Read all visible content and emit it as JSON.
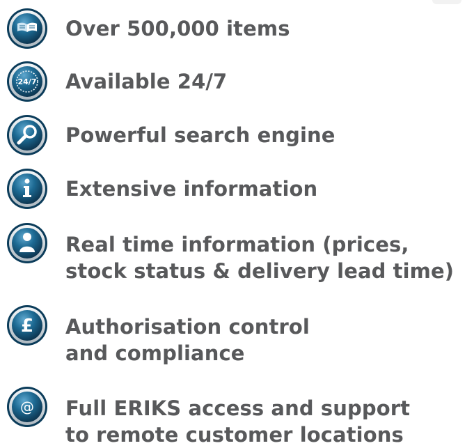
{
  "features": [
    {
      "icon": "book-icon",
      "lines": [
        "Over 500,000 items"
      ]
    },
    {
      "icon": "clock-24-7-icon",
      "badge": "24/7",
      "lines": [
        "Available 24/7"
      ]
    },
    {
      "icon": "magnifier-icon",
      "lines": [
        "Powerful search engine"
      ]
    },
    {
      "icon": "info-icon",
      "lines": [
        "Extensive information"
      ]
    },
    {
      "icon": "person-icon",
      "lines": [
        "Real time information (prices,",
        "stock status & delivery lead time)"
      ]
    },
    {
      "icon": "pound-icon",
      "badge": "£",
      "lines": [
        "Authorisation control",
        "and compliance"
      ]
    },
    {
      "icon": "at-icon",
      "badge": "@",
      "lines": [
        "Full ERIKS access and support",
        "to remote customer locations"
      ]
    }
  ],
  "colors": {
    "text": "#58595b",
    "icon_dark": "#0b3c5a",
    "icon_mid": "#1d6a93",
    "icon_light": "#5fa8cf",
    "ring": "#d7dfe5"
  }
}
